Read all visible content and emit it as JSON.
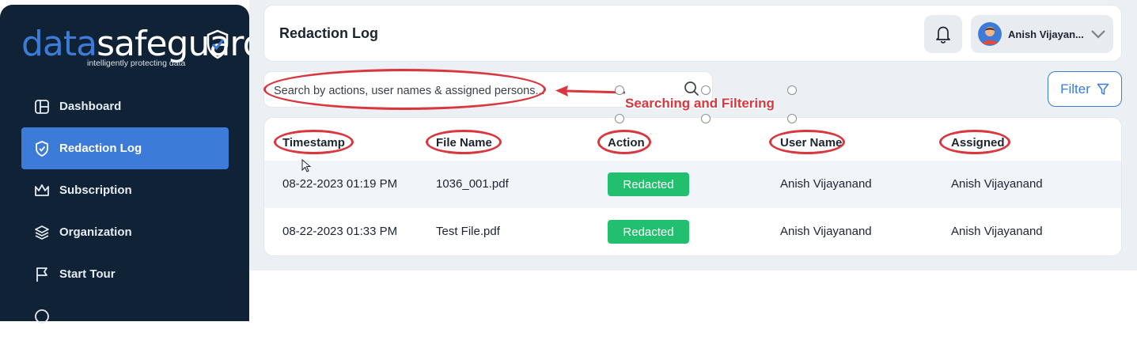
{
  "brand": {
    "word_data": "data",
    "word_safeguard": "safeguard",
    "tagline": "intelligently protecting data",
    "colors": {
      "primary": "#3c7bd8",
      "sidebar_bg": "#0f2236",
      "success": "#22c06e",
      "annotation": "#d9363e"
    }
  },
  "sidebar": {
    "items": [
      {
        "label": "Dashboard",
        "icon": "dashboard-icon",
        "active": false
      },
      {
        "label": "Redaction Log",
        "icon": "shield-check-icon",
        "active": true
      },
      {
        "label": "Subscription",
        "icon": "crown-icon",
        "active": false
      },
      {
        "label": "Organization",
        "icon": "layers-icon",
        "active": false
      },
      {
        "label": "Start Tour",
        "icon": "flag-icon",
        "active": false
      }
    ]
  },
  "header": {
    "title": "Redaction Log",
    "bell_icon": "bell-icon",
    "user_name": "Anish Vijayan..."
  },
  "search": {
    "placeholder": "Search by actions, user names & assigned persons...",
    "icon": "search-icon"
  },
  "filter": {
    "label": "Filter",
    "icon": "funnel-icon"
  },
  "table": {
    "columns": [
      "Timestamp",
      "File Name",
      "Action",
      "User Name",
      "Assigned"
    ],
    "rows": [
      {
        "timestamp": "08-22-2023 01:19 PM",
        "file_name": "1036_001.pdf",
        "action": "Redacted",
        "user_name": "Anish Vijayanand",
        "assigned": "Anish Vijayanand"
      },
      {
        "timestamp": "08-22-2023 01:33 PM",
        "file_name": "Test File.pdf",
        "action": "Redacted",
        "user_name": "Anish Vijayanand",
        "assigned": "Anish Vijayanand"
      }
    ]
  },
  "annotation": {
    "label": "Searching and Filtering"
  }
}
